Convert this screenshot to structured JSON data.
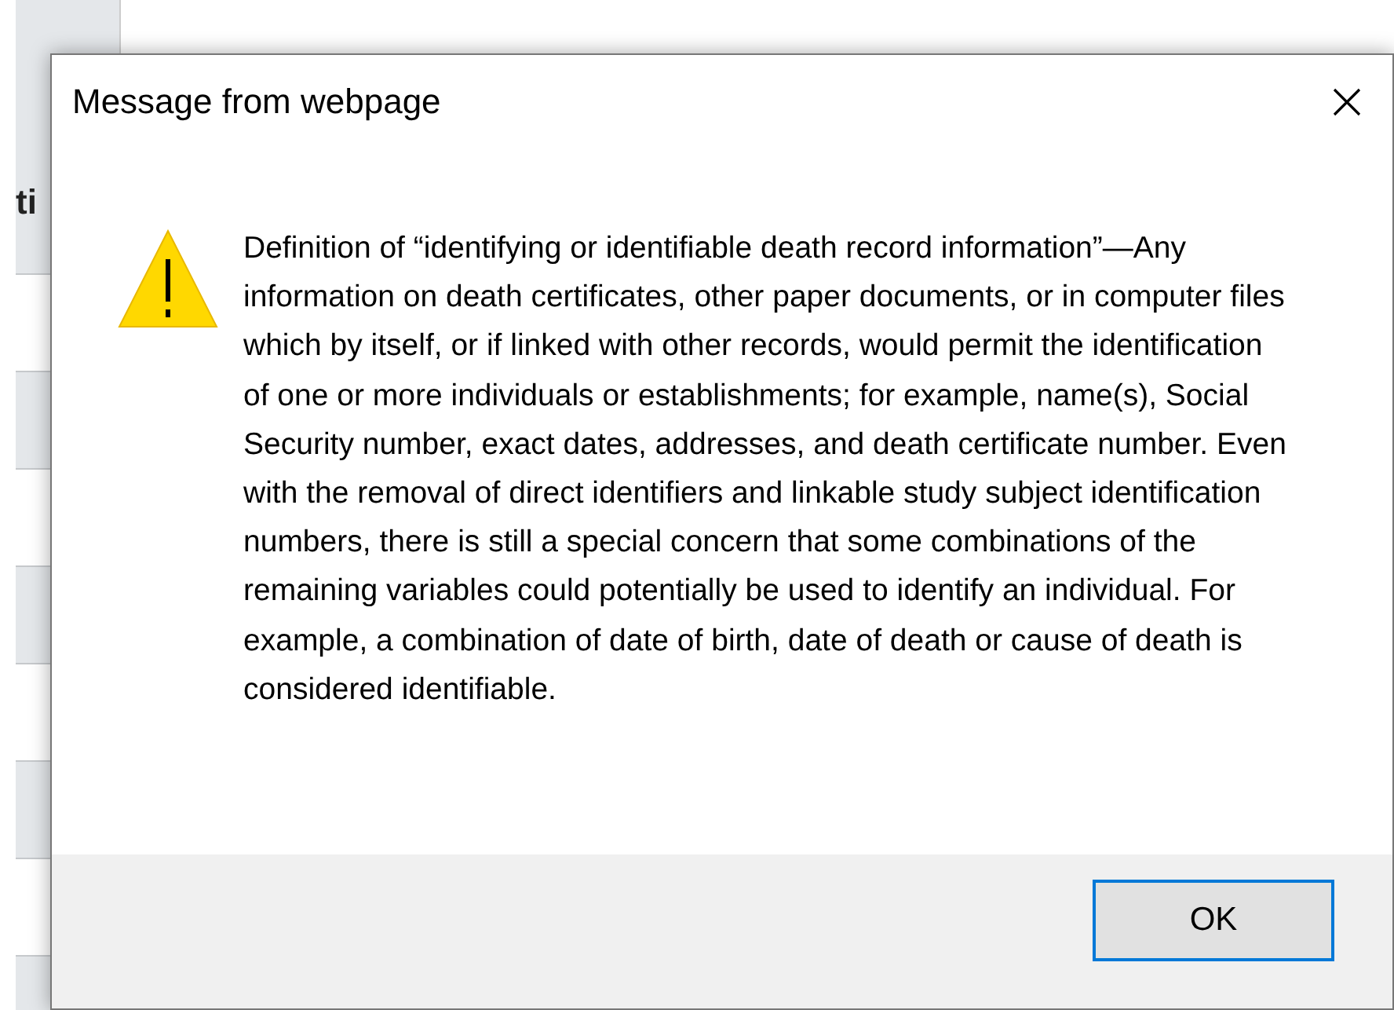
{
  "background_page": {
    "heading": "ti"
  },
  "dialog": {
    "title": "Message from webpage",
    "message": "Definition of “identifying or identifiable death record information”—Any information on death certificates, other paper documents, or in computer files which by itself, or if linked with other records, would permit the identification of one or more individuals or establishments; for example, name(s), Social Security number, exact dates, addresses, and death certificate number. Even with the removal of direct identifiers and linkable study subject identification numbers, there is still a special concern that some combinations of the remaining variables could potentially be used to identify an individual. For example, a combination of date of birth, date of death or cause of death is considered identifiable.",
    "buttons": [
      "OK"
    ]
  }
}
